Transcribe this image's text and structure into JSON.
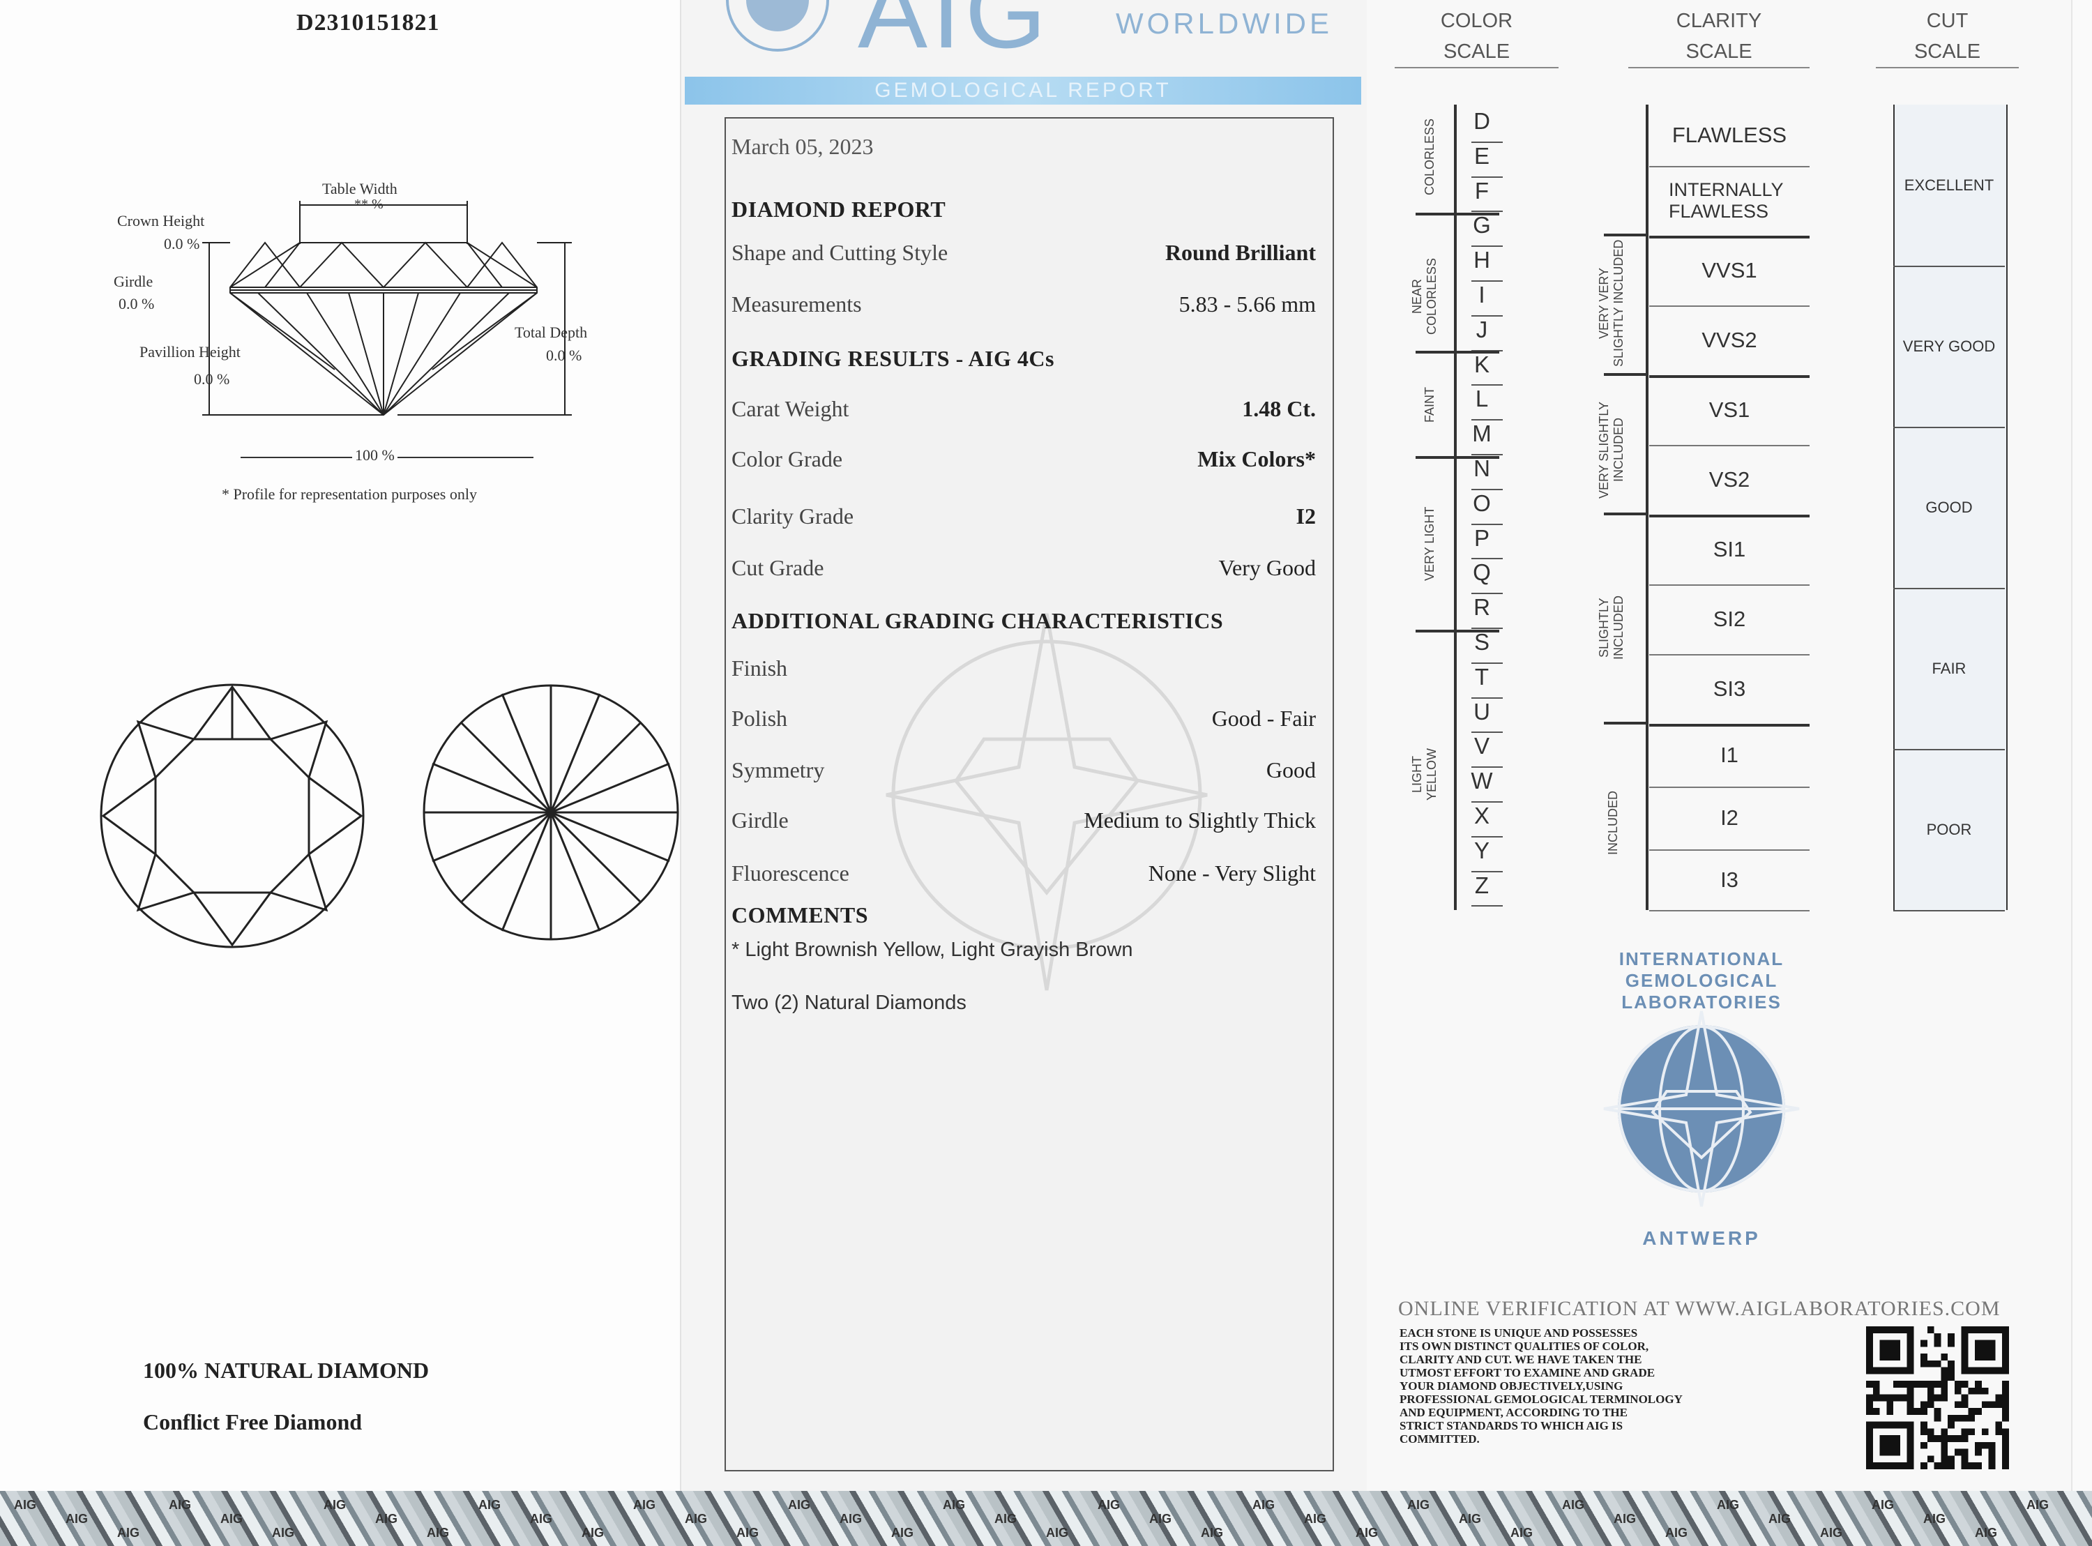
{
  "left": {
    "cert_number": "D2310151821",
    "diagram": {
      "table_width_label": "Table Width",
      "table_width_value": "** %",
      "crown_height_label": "Crown Height",
      "crown_height_value": "0.0 %",
      "girdle_label": "Girdle",
      "girdle_value": "0.0 %",
      "pavilion_height_label": "Pavillion Height",
      "pavilion_height_value": "0.0 %",
      "total_depth_label": "Total Depth",
      "total_depth_value": "0.0 %",
      "width_value": "100 %",
      "note": "* Profile for representation purposes only"
    },
    "natural_label": "100% NATURAL DIAMOND",
    "conflict_label": "Conflict Free Diamond"
  },
  "middle": {
    "brand": "AIG",
    "brand_sub": "WORLDWIDE",
    "banner": "GEMOLOGICAL REPORT",
    "date": "March 05, 2023",
    "diamond_report_title": "DIAMOND REPORT",
    "shape_label": "Shape and Cutting Style",
    "shape_value": "Round Brilliant",
    "measurements_label": "Measurements",
    "measurements_value": "5.83 -  5.66 mm",
    "grading_title": "GRADING RESULTS - AIG 4Cs",
    "carat_label": "Carat Weight",
    "carat_value": "1.48 Ct.",
    "color_label": "Color Grade",
    "color_value": "Mix Colors*",
    "clarity_label": "Clarity Grade",
    "clarity_value": "I2",
    "cut_label": "Cut Grade",
    "cut_value": "Very Good",
    "additional_title": "ADDITIONAL GRADING CHARACTERISTICS",
    "finish_label": "Finish",
    "polish_label": "Polish",
    "polish_value": "Good - Fair",
    "symmetry_label": "Symmetry",
    "symmetry_value": "Good",
    "girdle_label": "Girdle",
    "girdle_value": "Medium to Slightly Thick",
    "fluorescence_label": "Fluorescence",
    "fluorescence_value": "None - Very Slight",
    "comments_title": "COMMENTS",
    "comment_1": "* Light Brownish Yellow, Light Grayish Brown",
    "comment_2": "Two (2) Natural Diamonds"
  },
  "right": {
    "color_scale_title_1": "COLOR",
    "color_scale_title_2": "SCALE",
    "clarity_scale_title_1": "CLARITY",
    "clarity_scale_title_2": "SCALE",
    "cut_scale_title_1": "CUT",
    "cut_scale_title_2": "SCALE",
    "color_letters": [
      "D",
      "E",
      "F",
      "G",
      "H",
      "I",
      "J",
      "K",
      "L",
      "M",
      "N",
      "O",
      "P",
      "Q",
      "R",
      "S",
      "T",
      "U",
      "V",
      "W",
      "X",
      "Y",
      "Z"
    ],
    "color_groups": {
      "colorless": "COLORLESS",
      "near_colorless_1": "NEAR",
      "near_colorless_2": "COLORLESS",
      "faint": "FAINT",
      "very_light": "VERY LIGHT",
      "light_yellow_1": "LIGHT",
      "light_yellow_2": "YELLOW"
    },
    "clarity_grades": {
      "fl": "FLAWLESS",
      "if_1": "INTERNALLY",
      "if_2": "FLAWLESS",
      "vvs1": "VVS1",
      "vvs2": "VVS2",
      "vs1": "VS1",
      "vs2": "VS2",
      "si1": "SI1",
      "si2": "SI2",
      "si3": "SI3",
      "i1": "I1",
      "i2": "I2",
      "i3": "I3"
    },
    "clarity_groups": {
      "vvsi_1": "VERY VERY",
      "vvsi_2": "SLIGHTLY INCLUDED",
      "vsi_1": "VERY SLIGHTLY",
      "vsi_2": "INCLUDED",
      "si_1": "SLIGHTLY",
      "si_2": "INCLUDED",
      "i": "INCLUDED"
    },
    "cut_grades": [
      "EXCELLENT",
      "VERY GOOD",
      "GOOD",
      "FAIR",
      "POOR"
    ],
    "seal_text_top": "INTERNATIONAL GEMOLOGICAL LABORATORIES",
    "seal_text_bottom": "ANTWERP",
    "verification": "ONLINE VERIFICATION AT  WWW.AIGLABORATORIES.COM",
    "disclaimer_lines": [
      "EACH STONE IS UNIQUE AND POSSESSES",
      "ITS OWN DISTINCT QUALITIES OF COLOR,",
      "CLARITY AND CUT. WE HAVE TAKEN THE",
      "UTMOST EFFORT TO EXAMINE AND GRADE",
      "YOUR DIAMOND OBJECTIVELY,USING",
      "PROFESSIONAL GEMOLOGICAL TERMINOLOGY",
      "AND EQUIPMENT, ACCORDING TO THE",
      "STRICT STANDARDS TO WHICH AIG IS",
      "COMMITTED."
    ],
    "seal_color": "#5b7fa6"
  },
  "hologram_text": "AIG"
}
